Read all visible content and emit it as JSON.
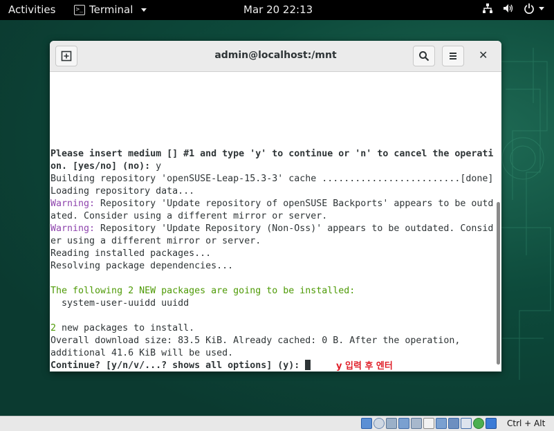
{
  "topbar": {
    "activities": "Activities",
    "app_name": "Terminal",
    "app_icon_glyph": ">_",
    "clock": "Mar 20  22:13",
    "tray_icons": [
      "network-icon",
      "volume-icon",
      "power-icon"
    ]
  },
  "window": {
    "title": "admin@localhost:/mnt",
    "new_tab_icon": "new-tab-icon",
    "search_icon": "search-icon",
    "menu_icon": "hamburger-menu-icon",
    "close_glyph": "✕"
  },
  "terminal": {
    "lines": [
      "Please insert medium [] #1 and type 'y' to continue or 'n' to cancel the operati",
      "on. [yes/no] (no): ",
      "y",
      "Building repository 'openSUSE-Leap-15.3-3' cache .........................[done]",
      "Loading repository data...",
      "Warning:",
      " Repository 'Update repository of openSUSE Backports' appears to be outd",
      "ated. Consider using a different mirror or server.",
      "Warning:",
      " Repository 'Update Repository (Non-Oss)' appears to be outdated. Consid",
      "er using a different mirror or server.",
      "Reading installed packages...",
      "Resolving package dependencies...",
      "The following 2 NEW packages are going to be installed:",
      "  system-user-uuidd uuidd",
      "2",
      " new packages to install.",
      "Overall download size: 83.5 KiB. Already cached: 0 B. After the operation,",
      "additional 41.6 KiB will be used.",
      "Continue? [y/n/v/...? shows all options] (y): "
    ],
    "annotation": "y 입력 후 엔터"
  },
  "statusbar": {
    "host_key": "Ctrl + Alt"
  },
  "colors": {
    "warning": "#8e44ad",
    "green": "#4e9a06",
    "annotation": "#e0202a",
    "terminal_text": "#2e3436"
  }
}
